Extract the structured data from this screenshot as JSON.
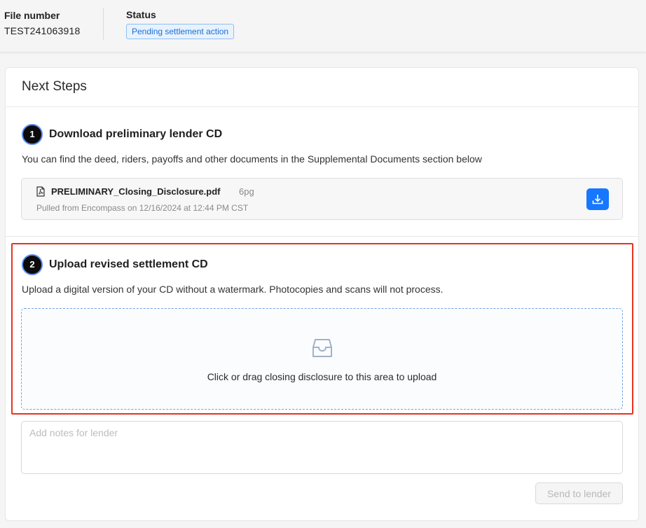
{
  "header": {
    "file_number_label": "File number",
    "file_number_value": "TEST241063918",
    "status_label": "Status",
    "status_badge": "Pending settlement action"
  },
  "card": {
    "title": "Next Steps"
  },
  "steps": [
    {
      "number": "1",
      "title": "Download preliminary lender CD",
      "description": "You can find the deed, riders, payoffs and other documents in the Supplemental Documents section below",
      "file": {
        "name": "PRELIMINARY_Closing_Disclosure.pdf",
        "pages": "6pg",
        "meta": "Pulled from Encompass on 12/16/2024 at 12:44 PM CST",
        "icon": "pdf-file-icon",
        "action_icon": "download-icon"
      }
    },
    {
      "number": "2",
      "title": "Upload revised settlement CD",
      "description": "Upload a digital version of your CD without a watermark. Photocopies and scans will not process.",
      "dropzone": {
        "icon": "inbox-icon",
        "text": "Click or drag closing disclosure to this area to upload"
      }
    }
  ],
  "notes": {
    "placeholder": "Add notes for lender",
    "value": ""
  },
  "send_button": {
    "label": "Send to lender",
    "disabled": true
  },
  "colors": {
    "primary": "#1677ff",
    "badge_bg": "#e8f2fd",
    "badge_text": "#1a6fd6",
    "highlight": "#e8321f",
    "step_ring": "#5b8def"
  }
}
